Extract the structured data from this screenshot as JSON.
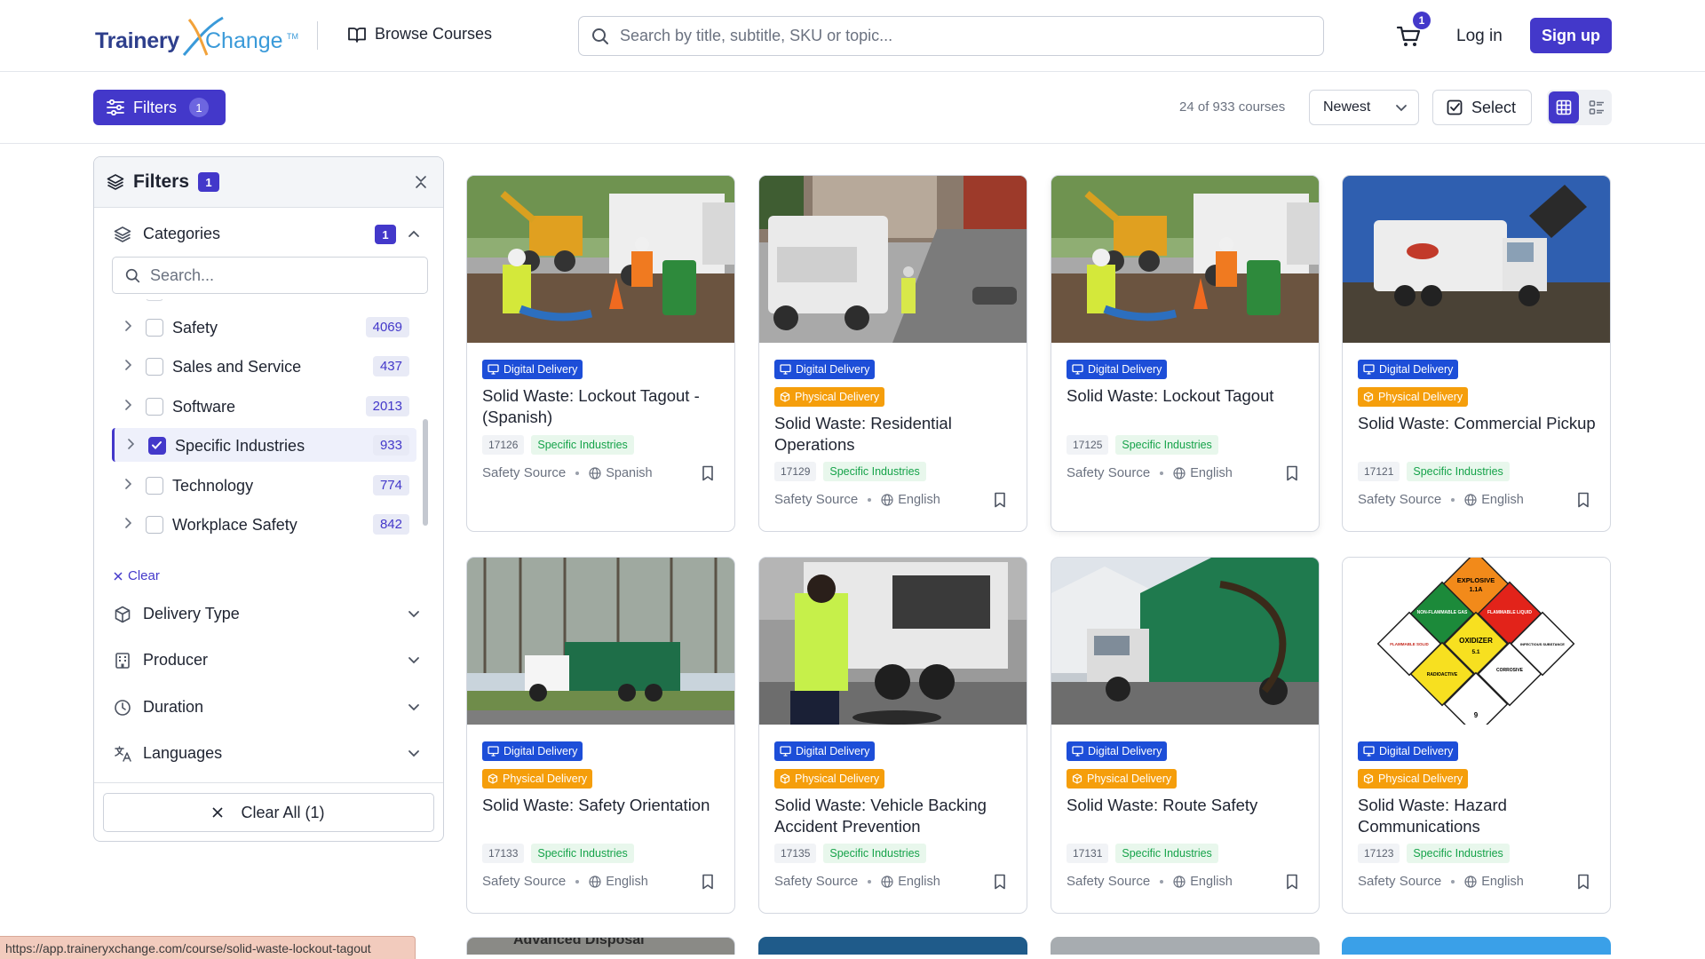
{
  "header": {
    "logo_part1": "Trainery",
    "logo_part2": "Change",
    "logo_tm": "TM",
    "browse_label": "Browse Courses",
    "search_placeholder": "Search by title, subtitle, SKU or topic...",
    "cart_count": "1",
    "login_label": "Log in",
    "signup_label": "Sign up",
    "accent_color": "#4338ca"
  },
  "toolbar": {
    "filters_label": "Filters",
    "filters_count": "1",
    "result_count": "24 of 933 courses",
    "sort_value": "Newest",
    "select_label": "Select",
    "view_mode": "grid"
  },
  "filters_panel": {
    "title": "Filters",
    "count": "1",
    "categories": {
      "title": "Categories",
      "count": "1",
      "search_placeholder": "Search...",
      "items": [
        {
          "label": "Safety",
          "count": "4069",
          "checked": false
        },
        {
          "label": "Sales and Service",
          "count": "437",
          "checked": false
        },
        {
          "label": "Software",
          "count": "2013",
          "checked": false
        },
        {
          "label": "Specific Industries",
          "count": "933",
          "checked": true
        },
        {
          "label": "Technology",
          "count": "774",
          "checked": false
        },
        {
          "label": "Workplace Safety",
          "count": "842",
          "checked": false
        }
      ],
      "clear_label": "Clear"
    },
    "sections": [
      "Delivery Type",
      "Producer",
      "Duration",
      "Languages"
    ],
    "clear_all_label": "Clear All (1)"
  },
  "courses": [
    {
      "title": "Solid Waste: Lockout Tagout - (Spanish)",
      "tags": [
        "Digital Delivery"
      ],
      "sku": "17126",
      "category": "Specific Industries",
      "producer": "Safety Source",
      "language": "Spanish"
    },
    {
      "title": "Solid Waste: Residential Operations",
      "tags": [
        "Digital Delivery",
        "Physical Delivery"
      ],
      "sku": "17129",
      "category": "Specific Industries",
      "producer": "Safety Source",
      "language": "English"
    },
    {
      "title": "Solid Waste: Lockout Tagout",
      "tags": [
        "Digital Delivery"
      ],
      "sku": "17125",
      "category": "Specific Industries",
      "producer": "Safety Source",
      "language": "English"
    },
    {
      "title": "Solid Waste: Commercial Pickup",
      "tags": [
        "Digital Delivery",
        "Physical Delivery"
      ],
      "sku": "17121",
      "category": "Specific Industries",
      "producer": "Safety Source",
      "language": "English"
    },
    {
      "title": "Solid Waste: Safety Orientation",
      "tags": [
        "Digital Delivery",
        "Physical Delivery"
      ],
      "sku": "17133",
      "category": "Specific Industries",
      "producer": "Safety Source",
      "language": "English"
    },
    {
      "title": "Solid Waste: Vehicle Backing Accident Prevention",
      "tags": [
        "Digital Delivery",
        "Physical Delivery"
      ],
      "sku": "17135",
      "category": "Specific Industries",
      "producer": "Safety Source",
      "language": "English"
    },
    {
      "title": "Solid Waste: Route Safety",
      "tags": [
        "Digital Delivery",
        "Physical Delivery"
      ],
      "sku": "17131",
      "category": "Specific Industries",
      "producer": "Safety Source",
      "language": "English"
    },
    {
      "title": "Solid Waste: Hazard Communications",
      "tags": [
        "Digital Delivery",
        "Physical Delivery"
      ],
      "sku": "17123",
      "category": "Specific Industries",
      "producer": "Safety Source",
      "language": "English"
    }
  ],
  "hazmat_labels": {
    "explosive": "EXPLOSIVE",
    "explosive_class": "1.1A",
    "nonflam": "NON-FLAMMABLE GAS",
    "flammable_liq": "FLAMMABLE LIQUID",
    "flammable_solid": "FLAMMABLE SOLID",
    "oxidizer": "OXIDIZER",
    "oxidizer_class": "5.1",
    "infectious": "INFECTIOUS SUBSTANCE",
    "radioactive": "RADIOACTIVE",
    "corrosive": "CORROSIVE",
    "class9": "9"
  },
  "peek_texts": [
    "Advanced Disposal"
  ],
  "status_url": "https://app.traineryxchange.com/course/solid-waste-lockout-tagout"
}
